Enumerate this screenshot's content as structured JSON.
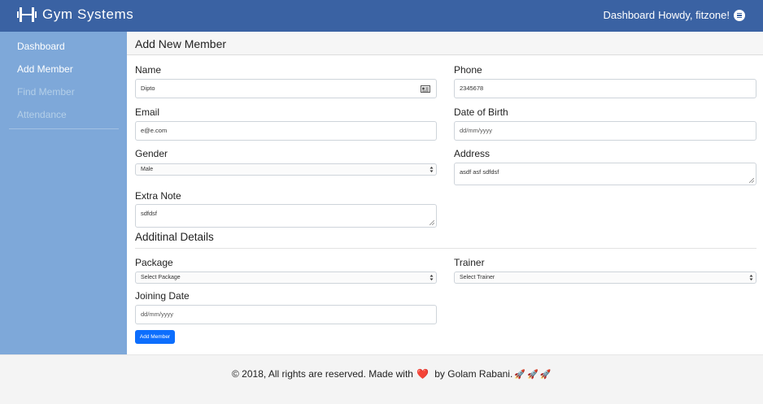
{
  "header": {
    "brand": "Gym Systems",
    "dashboard_link": "Dashboard",
    "greeting": "Howdy, fitzone!"
  },
  "sidebar": {
    "items": [
      {
        "label": "Dashboard"
      },
      {
        "label": "Add Member"
      },
      {
        "label": "Find Member"
      },
      {
        "label": "Attendance"
      }
    ]
  },
  "page": {
    "title": "Add New Member"
  },
  "form": {
    "name": {
      "label": "Name",
      "value": "Dipto"
    },
    "phone": {
      "label": "Phone",
      "value": "2345678"
    },
    "email": {
      "label": "Email",
      "value": "e@e.com"
    },
    "dob": {
      "label": "Date of Birth",
      "placeholder": "dd/mm/yyyy"
    },
    "gender": {
      "label": "Gender",
      "value": "Male"
    },
    "address": {
      "label": "Address",
      "value": "asdf asf sdfdsf"
    },
    "extra_note": {
      "label": "Extra Note",
      "value": "sdfdsf"
    },
    "section_title": "Additinal Details",
    "package": {
      "label": "Package",
      "value": "Select Package"
    },
    "trainer": {
      "label": "Trainer",
      "value": "Select Trainer"
    },
    "joining_date": {
      "label": "Joining Date",
      "placeholder": "dd/mm/yyyy"
    },
    "submit_label": "Add Member"
  },
  "footer": {
    "text_before": "© 2018, All rights are reserved. Made with",
    "heart": "❤️",
    "text_after": " by Golam Rabani.",
    "rockets": [
      "🚀",
      "🚀",
      "🚀"
    ]
  },
  "colors": {
    "topbar": "#3a62a3",
    "sidebar": "#7ea8d9",
    "primary_button": "#0d6efd"
  },
  "icons": [
    "brand-dumbbell-icon",
    "user-menu-icon",
    "contact-card-icon",
    "chevron-updown-icon",
    "resize-grip-icon",
    "heart-icon",
    "rocket-icon"
  ]
}
